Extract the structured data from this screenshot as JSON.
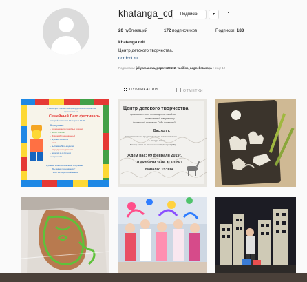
{
  "profile": {
    "username": "khatanga_cdt",
    "subscribe_label": "Подписки",
    "dropdown_glyph": "▾",
    "more_glyph": "···",
    "stats": {
      "posts_count": "20",
      "posts_label": " публикаций",
      "followers_count": "172",
      "followers_label": " подписчиков",
      "following_label": "Подписки: ",
      "following_count": "183"
    },
    "full_name": "khatanga.cdt",
    "bio": "Центр детского творчества.",
    "link": "nordcdt.ru",
    "followed_by_prefix": "Подписаны: ",
    "followed_by_names": "jaliyamaneva, popova29192, vasilisa_nagnebrzasaya",
    "followed_by_suffix": " + ещё 12"
  },
  "tabs": [
    {
      "label": "ПУБЛИКАЦИИ",
      "icon": "grid-icon",
      "active": true
    },
    {
      "label": "ОТМЕТКИ",
      "icon": "tag-icon",
      "active": false
    }
  ],
  "posts": [
    {
      "subject": "lego-festival-poster",
      "text_lines": [
        "ТМК ОУДО \"Хатангский центр детского творчества\"",
        "приглашает на",
        "Семейный Лего фестиваль",
        "который состоится 10 марта в 15:00",
        "В программе:",
        "- соревнования семейных команд",
        "- робот прыгает",
        "- Флэшмоб танцевальный",
        "- игровые комнаты",
        "- гонки",
        "- выставка Лего-моделей",
        "- награды победителям",
        "- посетим в отличном",
        "настроении!",
        "В рамках Благотворительной программы",
        "\"Мы живем экономически\"",
        "ТМО ТМК Норильский никель"
      ]
    },
    {
      "subject": "invitation-poster",
      "text_lines": [
        "Центр детского творчества",
        "приглашает всех желающих на праздник,",
        "посвященный творчеству",
        "долганской поэтессы Огдо Аксеновой.",
        "Вас ждут:",
        "Театрализованное представление по сказке \"Хатанга\"",
        "• Конкурс стихов",
        "• Мастер-класс по изготовлению Сувениров (3D)",
        "Ждём вас: 09 февраля 2019г.",
        "в актовом зале ХСШ №1",
        "Начало: 15:00ч."
      ]
    },
    {
      "subject": "decorated-cookies-board",
      "text_lines": []
    },
    {
      "subject": "green-cookies-in-bag",
      "text_lines": []
    },
    {
      "subject": "kids-with-balloons",
      "text_lines": []
    },
    {
      "subject": "city-stage-decoration",
      "text_lines": []
    }
  ]
}
